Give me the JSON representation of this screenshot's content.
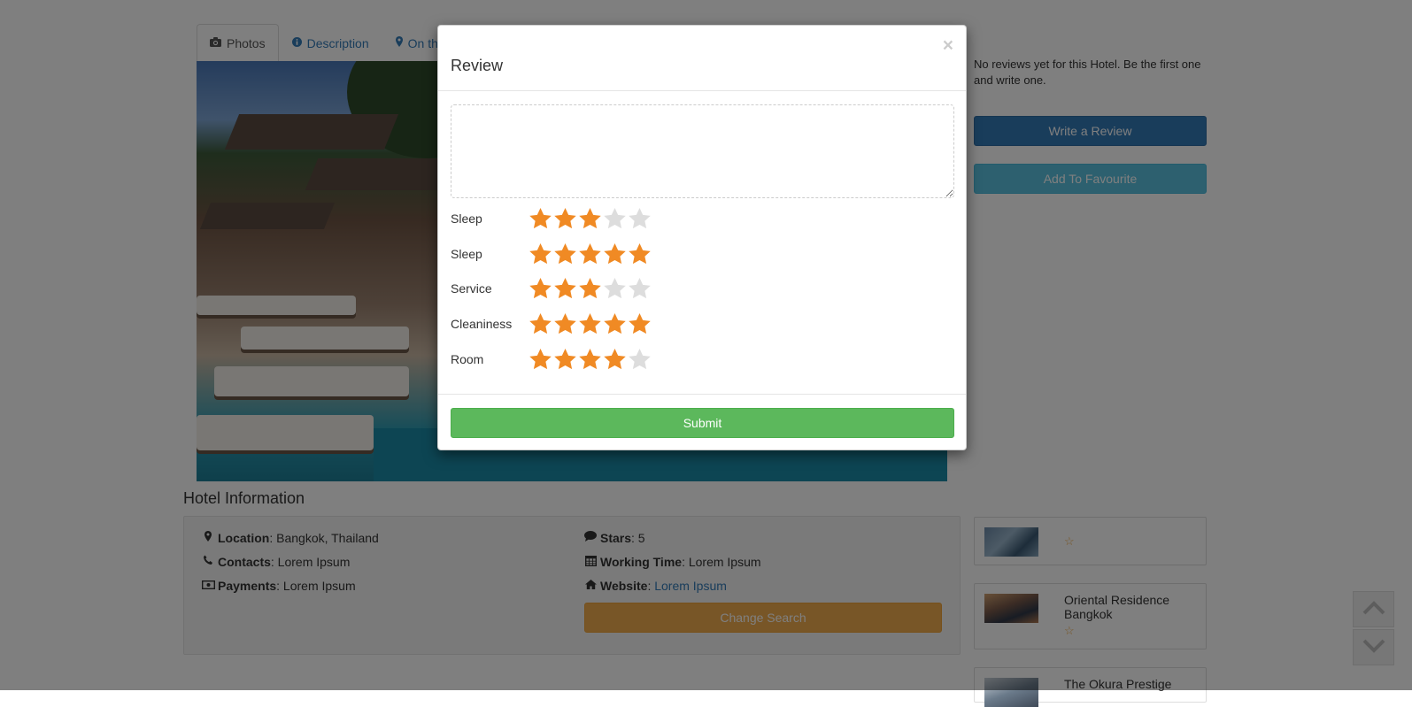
{
  "tabs": [
    {
      "label": "Photos",
      "icon": "camera-icon"
    },
    {
      "label": "Description",
      "icon": "info-icon"
    },
    {
      "label": "On th",
      "icon": "map-marker-icon"
    }
  ],
  "hotel_info": {
    "title": "Hotel Information",
    "location_label": "Location",
    "location_value": ": Bangkok, Thailand",
    "contacts_label": "Contacts",
    "contacts_value": ": Lorem Ipsum",
    "payments_label": "Payments",
    "payments_value": ": Lorem Ipsum",
    "stars_label": "Stars",
    "stars_value": ": 5",
    "working_time_label": "Working Time",
    "working_time_value": ": Lorem Ipsum",
    "website_label": "Website",
    "website_sep": ": ",
    "website_value": "Lorem Ipsum",
    "change_search": "Change Search"
  },
  "sidebar": {
    "reviews_text": "No reviews yet for this Hotel. Be the first one and write one.",
    "write_review": "Write a Review",
    "add_favourite": "Add To Favourite",
    "hotels": [
      {
        "name": "",
        "stars": "☆"
      },
      {
        "name": "Oriental Residence Bangkok",
        "stars": "☆"
      },
      {
        "name": "The Okura Prestige",
        "stars": ""
      }
    ]
  },
  "modal": {
    "title": "Review",
    "close": "×",
    "review_value": "",
    "ratings": [
      {
        "label": "Sleep",
        "value": 3
      },
      {
        "label": "Sleep",
        "value": 5
      },
      {
        "label": "Service",
        "value": 3
      },
      {
        "label": "Cleaniness",
        "value": 5
      },
      {
        "label": "Room",
        "value": 4
      }
    ],
    "max_rating": 5,
    "submit": "Submit"
  },
  "colors": {
    "star_filled": "#f08a24",
    "star_empty": "#dddddd",
    "submit": "#5cb85c",
    "primary": "#337ab7",
    "info": "#5bc0de",
    "warning": "#f0ad4e"
  }
}
